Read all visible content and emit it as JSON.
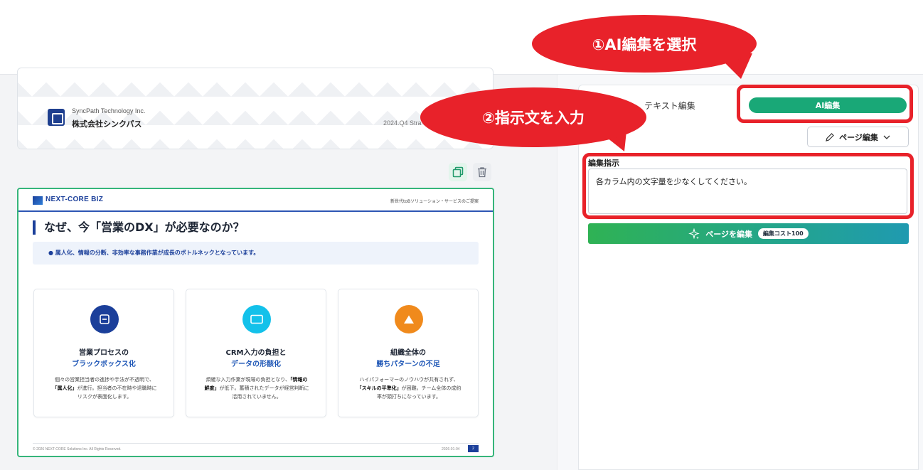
{
  "preview_slide": {
    "company_en": "SyncPath Technology Inc.",
    "company_ja": "株式会社シンクパス",
    "date_text": "2024.Q4 Stra"
  },
  "slide_actions": {
    "duplicate_icon": "copy-icon",
    "delete_icon": "trash-icon"
  },
  "slide": {
    "brand": "NEXT-CORE BIZ",
    "header_note": "新世代toBソリューション・サービスのご提案",
    "title": "なぜ、今「営業のDX」が必要なのか？",
    "lead": "● 属人化、情報の分断、非効率な事務作業が成長のボトルネックとなっています。",
    "columns": [
      {
        "icon": "minus-box-icon",
        "icon_color": "#1b3f9a",
        "title_line1": "営業プロセスの",
        "title_line2": "ブラックボックス化",
        "body_html": "個々の営業担当者の進捗や手法が不透明で、<br><b>「属人化」</b>が進行。担当者の不在時や退職時に<br>リスクが表面化します。"
      },
      {
        "icon": "screen-icon",
        "icon_color": "#13c1ea",
        "title_line1": "CRM入力の負担と",
        "title_line2": "データの形骸化",
        "body_html": "煩雑な入力作業が現場の負担となり、<b>「情報の<br>鮮度」</b>が低下。蓄積されたデータが経営判断に<br>活用されていません。"
      },
      {
        "icon": "triangle-icon",
        "icon_color": "#f08a1c",
        "title_line1": "組織全体の",
        "title_line2": "勝ちパターンの不足",
        "body_html": "ハイパフォーマーのノウハウが共有されず、<br><b>「スキルの平準化」</b>が困難。チーム全体の成約<br>率が頭打ちになっています。"
      }
    ],
    "copyright": "© 2026 NEXT-CORE Solutions Inc. All Rights Reserved.",
    "footer_date": "2026-01-04",
    "page_number": "2"
  },
  "panel": {
    "tab_text_edit": "テキスト編集",
    "tab_ai_edit": "AI編集",
    "page_edit_dropdown": "ページ編集",
    "instruction_label": "編集指示",
    "instruction_value": "各カラム内の文字量を少なくしてください。",
    "run_button": "ページを編集",
    "cost_badge": "編集コスト100",
    "accent_color": "#19a877"
  },
  "annotations": {
    "step1": "①AI編集を選択",
    "step2": "②指示文を入力",
    "color": "#e8222a"
  }
}
